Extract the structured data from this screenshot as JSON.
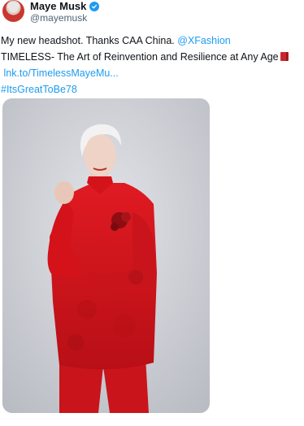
{
  "author": {
    "display_name": "Maye Musk",
    "handle": "@mayemusk",
    "verified": true
  },
  "tweet": {
    "line1_text": "My new headshot. Thanks CAA China. ",
    "line1_mention": "@XFashion",
    "line2_text": "TIMELESS- The Art of Reinvention and Resilience at Any Age",
    "line3_link": "lnk.to/TimelessMayeMu...",
    "line4_hashtag": "#ItsGreatToBe78"
  },
  "colors": {
    "link": "#1d9bf0",
    "text": "#0f1419",
    "secondary": "#536471",
    "outfit_red": "#d3121a"
  },
  "icons": {
    "verified": "verified-badge-icon",
    "book": "red-book-emoji-icon"
  }
}
